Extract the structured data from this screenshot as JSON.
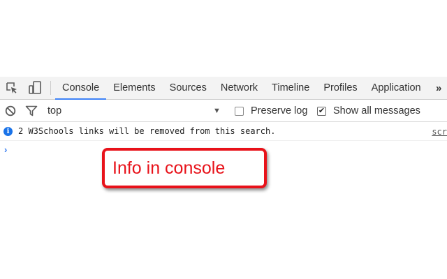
{
  "tabs": [
    {
      "label": "Console",
      "active": true
    },
    {
      "label": "Elements"
    },
    {
      "label": "Sources"
    },
    {
      "label": "Network"
    },
    {
      "label": "Timeline"
    },
    {
      "label": "Profiles"
    },
    {
      "label": "Application"
    }
  ],
  "more_label": "»",
  "filter": {
    "context": "top",
    "context_arrow": "▼",
    "preserve_log": {
      "label": "Preserve log",
      "checked": false
    },
    "show_all": {
      "label": "Show all messages",
      "checked": true,
      "check_mark": "✔"
    }
  },
  "message": {
    "icon": "info-icon",
    "text": "2 W3Schools links will be removed from this search.",
    "source": "scr"
  },
  "prompt_symbol": "›",
  "callout": {
    "text": "Info in console",
    "color": "#e8121a"
  },
  "colors": {
    "accent": "#3e82f7",
    "info": "#1a73e8",
    "prompt": "#367cf1"
  }
}
